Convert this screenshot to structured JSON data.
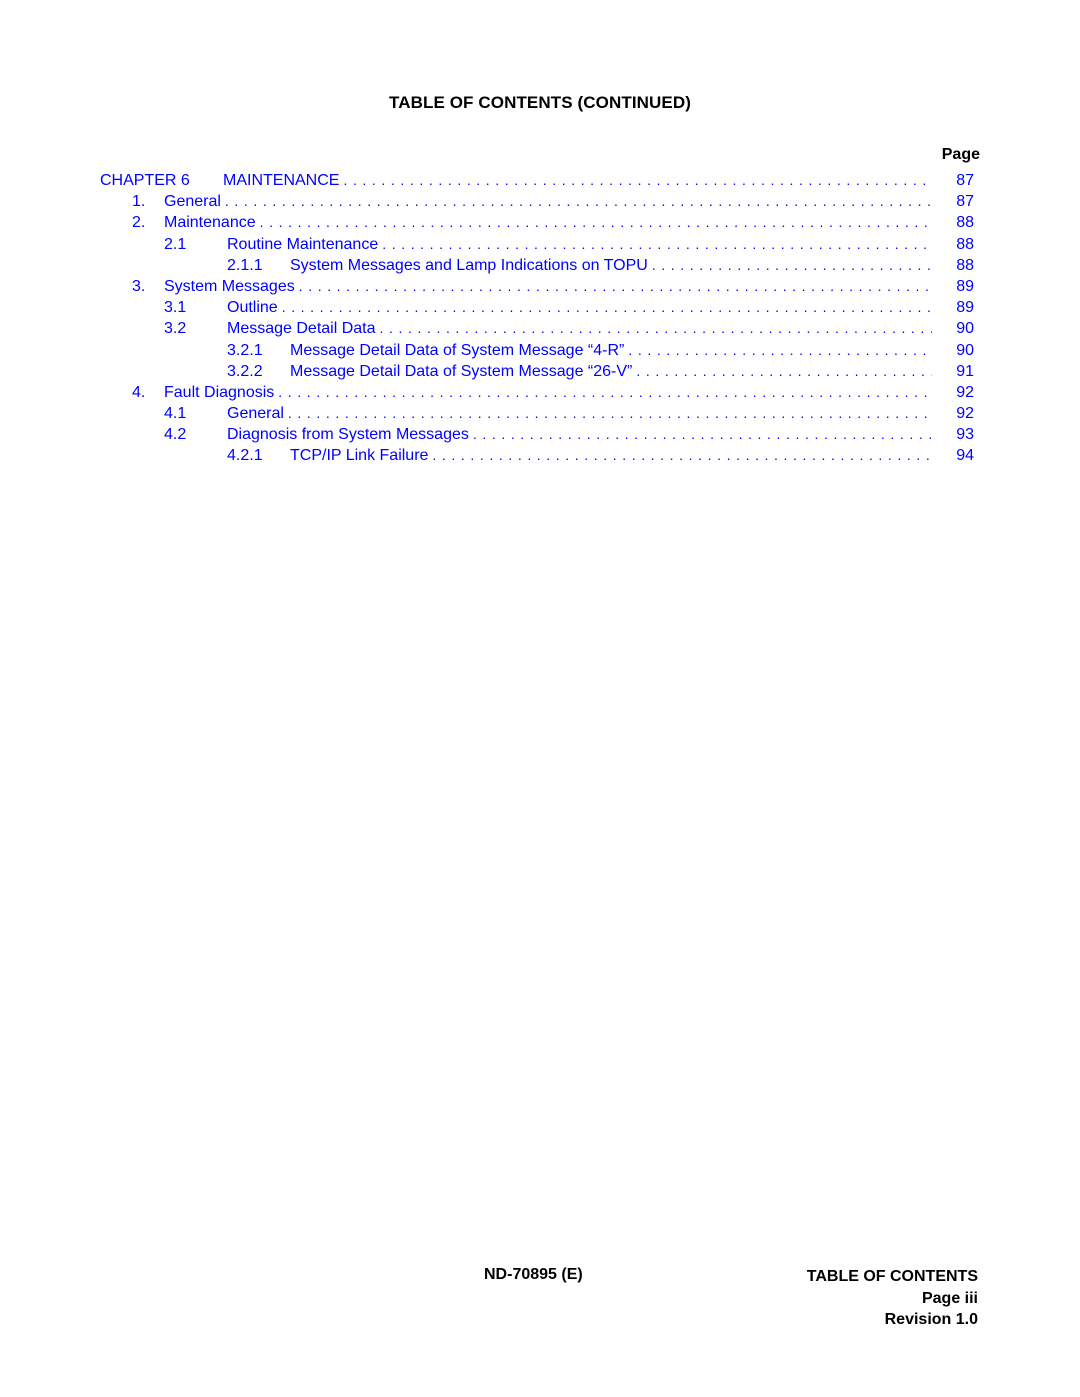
{
  "header": {
    "title": "TABLE OF CONTENTS  (CONTINUED)",
    "page_column_label": "Page"
  },
  "toc": [
    {
      "level": 0,
      "number": "CHAPTER 6",
      "label": "MAINTENANCE",
      "page": "87"
    },
    {
      "level": 1,
      "number": "1.",
      "label": "General",
      "page": "87"
    },
    {
      "level": 1,
      "number": "2.",
      "label": "Maintenance",
      "page": "88"
    },
    {
      "level": 2,
      "number": "2.1",
      "label": "Routine Maintenance",
      "page": "88"
    },
    {
      "level": 3,
      "number": "2.1.1",
      "label": "System Messages and Lamp Indications on TOPU",
      "page": "88"
    },
    {
      "level": 1,
      "number": "3.",
      "label": "System Messages",
      "page": "89"
    },
    {
      "level": 2,
      "number": "3.1",
      "label": "Outline",
      "page": "89"
    },
    {
      "level": 2,
      "number": "3.2",
      "label": "Message Detail Data",
      "page": "90"
    },
    {
      "level": 3,
      "number": "3.2.1",
      "label": "Message Detail Data of System Message “4-R”",
      "page": "90"
    },
    {
      "level": 3,
      "number": "3.2.2",
      "label": "Message Detail Data of System Message “26-V”",
      "page": "91"
    },
    {
      "level": 1,
      "number": "4.",
      "label": "Fault Diagnosis",
      "page": "92"
    },
    {
      "level": 2,
      "number": "4.1",
      "label": "General",
      "page": "92"
    },
    {
      "level": 2,
      "number": "4.2",
      "label": "Diagnosis from System Messages",
      "page": "93"
    },
    {
      "level": 3,
      "number": "4.2.1",
      "label": "TCP/IP Link Failure",
      "page": "94"
    }
  ],
  "footer": {
    "document_id": "ND-70895 (E)",
    "section": "TABLE OF CONTENTS",
    "page": "Page iii",
    "revision": "Revision 1.0"
  },
  "colors": {
    "link": "#0000ff",
    "text": "#000000"
  }
}
